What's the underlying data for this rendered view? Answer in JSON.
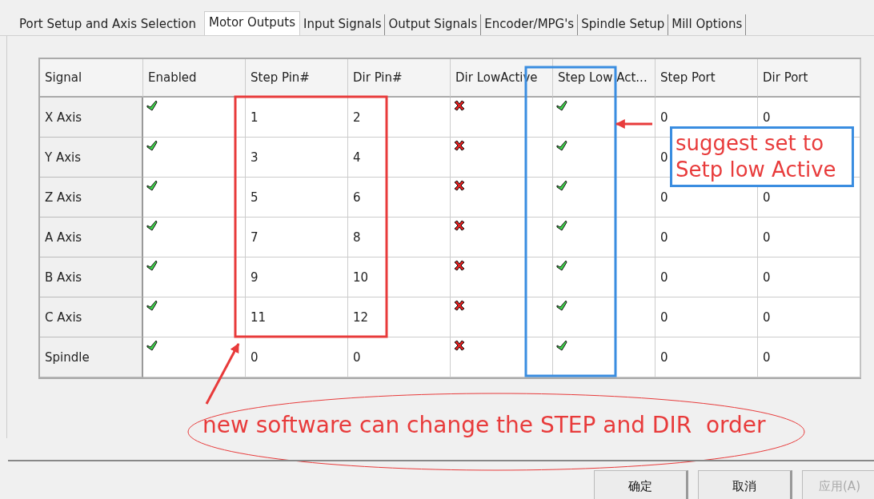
{
  "tabs": [
    {
      "label": "Port Setup and Axis Selection",
      "selected": false
    },
    {
      "label": "Motor Outputs",
      "selected": true
    },
    {
      "label": "Input Signals",
      "selected": false
    },
    {
      "label": "Output Signals",
      "selected": false
    },
    {
      "label": "Encoder/MPG's",
      "selected": false
    },
    {
      "label": "Spindle Setup",
      "selected": false
    },
    {
      "label": "Mill Options",
      "selected": false
    }
  ],
  "table": {
    "columns": [
      "Signal",
      "Enabled",
      "Step Pin#",
      "Dir Pin#",
      "Dir LowActive",
      "Step Low Act...",
      "Step Port",
      "Dir Port"
    ],
    "rows": [
      {
        "signal": "X Axis",
        "enabled": true,
        "step_pin": "1",
        "dir_pin": "2",
        "dir_low_active": false,
        "step_low_active": true,
        "step_port": "0",
        "dir_port": "0"
      },
      {
        "signal": "Y Axis",
        "enabled": true,
        "step_pin": "3",
        "dir_pin": "4",
        "dir_low_active": false,
        "step_low_active": true,
        "step_port": "0"
      },
      {
        "signal": "Z Axis",
        "enabled": true,
        "step_pin": "5",
        "dir_pin": "6",
        "dir_low_active": false,
        "step_low_active": true,
        "step_port": "0",
        "dir_port": "0"
      },
      {
        "signal": "A Axis",
        "enabled": true,
        "step_pin": "7",
        "dir_pin": "8",
        "dir_low_active": false,
        "step_low_active": true,
        "step_port": "0",
        "dir_port": "0"
      },
      {
        "signal": "B Axis",
        "enabled": true,
        "step_pin": "9",
        "dir_pin": "10",
        "dir_low_active": false,
        "step_low_active": true,
        "step_port": "0",
        "dir_port": "0"
      },
      {
        "signal": "C Axis",
        "enabled": true,
        "step_pin": "11",
        "dir_pin": "12",
        "dir_low_active": false,
        "step_low_active": true,
        "step_port": "0",
        "dir_port": "0"
      },
      {
        "signal": "Spindle",
        "enabled": true,
        "step_pin": "0",
        "dir_pin": "0",
        "dir_low_active": false,
        "step_low_active": true,
        "step_port": "0",
        "dir_port": "0"
      }
    ]
  },
  "annotations": {
    "suggestion": [
      "suggest set to",
      "Setp low Active"
    ],
    "note": "new software can change the STEP and DIR  order"
  },
  "buttons": [
    {
      "label": "确定",
      "disabled": false
    },
    {
      "label": "取消",
      "disabled": false
    },
    {
      "label": "应用(A)",
      "disabled": true
    }
  ]
}
